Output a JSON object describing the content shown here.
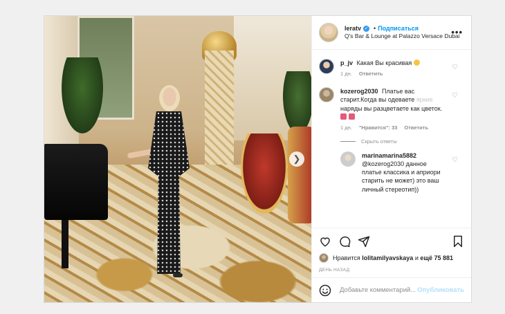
{
  "post": {
    "username": "leratv",
    "follow_label": "Подписаться",
    "location": "Q's Bar & Lounge at Palazzo Versace Dubai",
    "more_label": "•••"
  },
  "comments": [
    {
      "username": "p_jv",
      "text": "Какая Вы красивая",
      "time": "1 дн.",
      "reply_label": "Ответить"
    },
    {
      "username": "kozerog2030",
      "text_main": "Платье вас старит.Когда вы одеваете ",
      "text_faded": "яркие",
      "text_end": " наряды вы разцветаете как цветок.",
      "time": "1 дн.",
      "likes": "\"Нравится\": 33",
      "reply_label": "Ответить",
      "hide_replies": "Скрыть ответы"
    },
    {
      "username": "marinamarina5882",
      "text": "@kozerog2030 данное платье классика и априори старить не может) это ваш личный стереотип))"
    }
  ],
  "likes": {
    "prefix": "Нравится ",
    "user": "lolitamilyavskaya",
    "connector": " и ",
    "count": "ещё 75 881"
  },
  "posted_ago": "ДЕНЬ НАЗАД",
  "add_comment": {
    "placeholder": "Добавьте комментарий...",
    "post_label": "Опубликовать"
  },
  "icons": {
    "heart": "heart-icon",
    "comment": "comment-icon",
    "share": "share-icon",
    "bookmark": "bookmark-icon",
    "emoji": "emoji-icon",
    "next": "chevron-right-icon"
  },
  "colors": {
    "link_blue": "#0095f6",
    "muted": "#8e8e8e",
    "post_disabled": "#b2dffc"
  }
}
